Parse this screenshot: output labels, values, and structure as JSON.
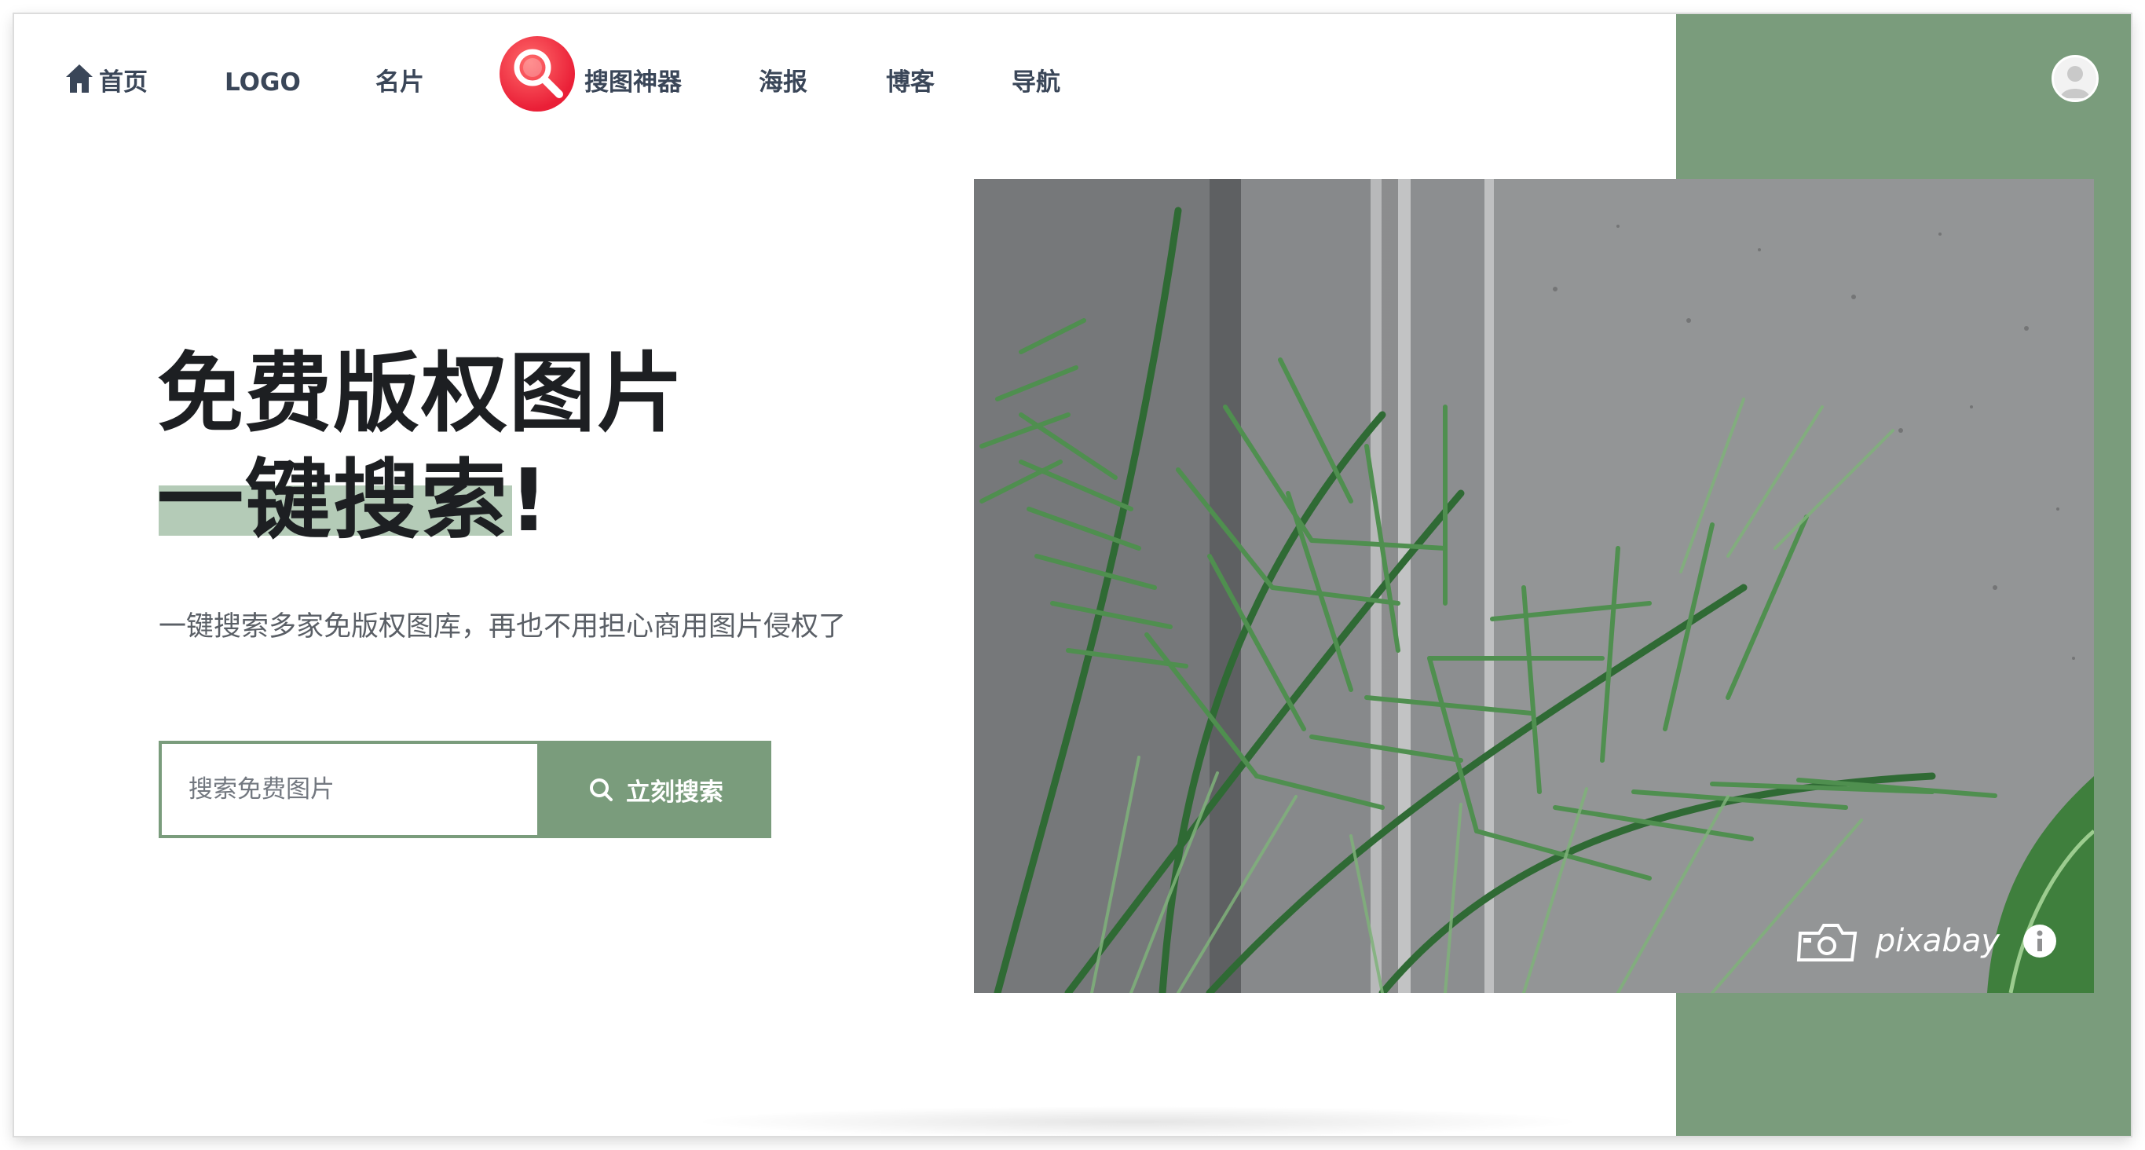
{
  "nav": {
    "home": "首页",
    "logo": "LOGO",
    "card": "名片",
    "brand": "搜图神器",
    "poster": "海报",
    "blog": "博客",
    "guide": "导航"
  },
  "hero": {
    "title_line1": "免费版权图片",
    "title_line2": "一键搜索!",
    "subtitle": "一键搜索多家免版权图库，再也不用担心商用图片侵权了"
  },
  "search": {
    "placeholder": "搜索免费图片",
    "value": "",
    "button_label": "立刻搜索"
  },
  "photo": {
    "watermark": "pixabay",
    "info_icon": "info-icon"
  },
  "colors": {
    "accent": "#7a9c7c",
    "highlight": "#b4cbb7",
    "brand_red": "#ea1f37",
    "nav_text": "#3a4658"
  }
}
